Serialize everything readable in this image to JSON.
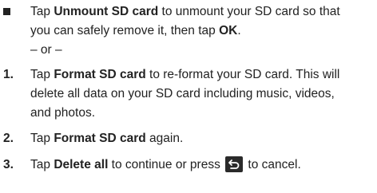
{
  "items": [
    {
      "marker": "",
      "lines": [
        [
          "Tap ",
          "Unmount SD card",
          " to unmount your SD card so that"
        ],
        [
          "you can safely remove it, then tap ",
          "OK",
          "."
        ]
      ]
    },
    {
      "separator": "– or –"
    },
    {
      "marker": "1.",
      "lines": [
        [
          "Tap ",
          "Format SD card",
          " to re-format your SD card. This will"
        ],
        [
          "delete all data on your SD card including music, videos,"
        ],
        [
          "and photos."
        ]
      ]
    },
    {
      "marker": "2.",
      "lines": [
        [
          "Tap ",
          "Format SD card",
          " again."
        ]
      ]
    },
    {
      "marker": "3.",
      "lines": [
        [
          "Tap ",
          "Delete all",
          " to continue or press ",
          "back-icon",
          " to cancel."
        ]
      ]
    }
  ]
}
